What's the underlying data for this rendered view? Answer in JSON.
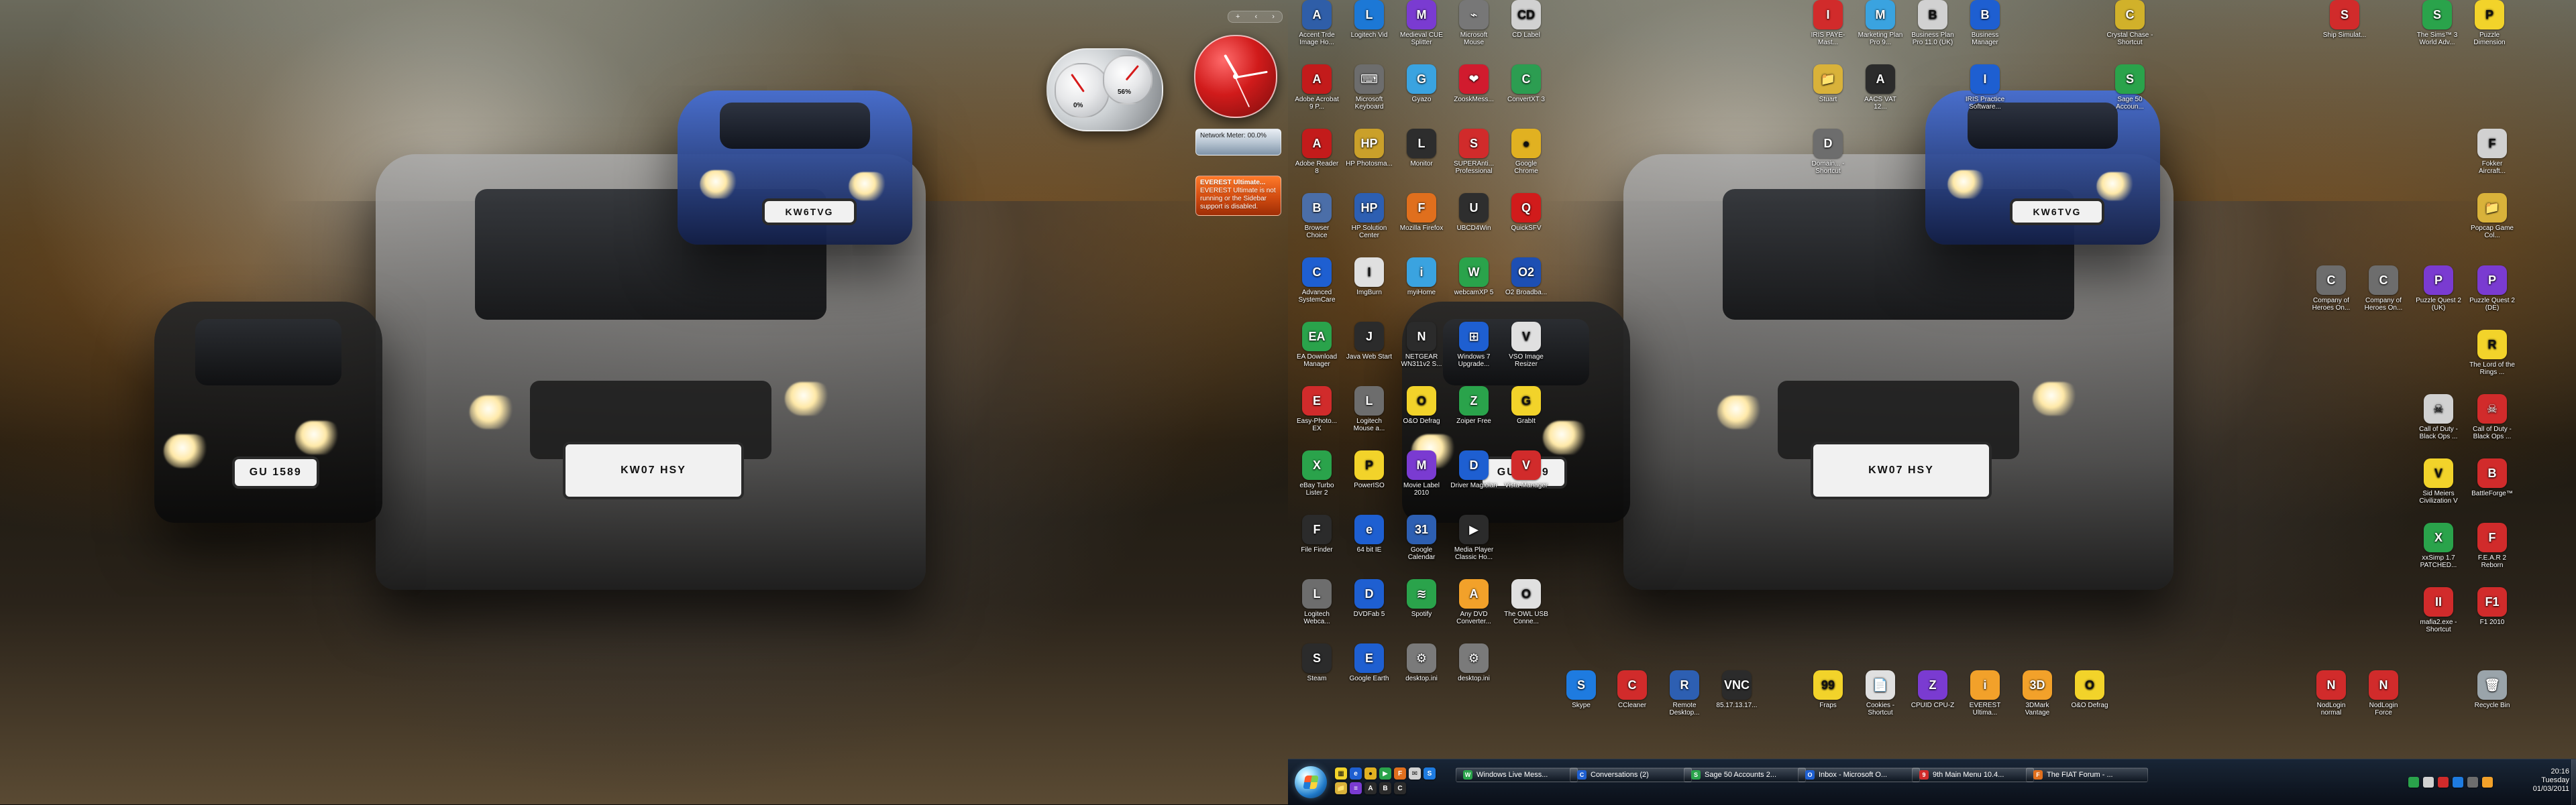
{
  "wallpaper": {
    "left": {
      "plate_front": "KW07 HSY",
      "plate_left": "GU 1589",
      "plate_back": "KW6TVG"
    },
    "right": {
      "plate_front": "KW07 HSY",
      "plate_left": "GU 1589",
      "plate_back": "KW6TVG"
    }
  },
  "sidebar": {
    "controls": [
      "+",
      "‹",
      "›"
    ],
    "network_meter": "Network Meter: 00.0%",
    "everest_lines": [
      "EVEREST Ultimate...",
      "EVEREST Ultimate is not",
      "running or the Sidebar",
      "support is disabled."
    ],
    "cpu_gauge": {
      "cpu_pct": "0%",
      "mem_pct": "56%"
    }
  },
  "desktop": {
    "left_grid": [
      {
        "name": "accent-image-icon",
        "label": "Accent Trde Image Ho...",
        "glyph": "A",
        "color": "#2f5ea8"
      },
      {
        "name": "logitech-vid-icon",
        "label": "Logitech Vid",
        "glyph": "L",
        "color": "#1c78d6"
      },
      {
        "name": "medieval-cue-splitter-icon",
        "label": "Medieval CUE Splitter",
        "glyph": "M",
        "color": "#7a3bd1"
      },
      {
        "name": "microsoft-mouse-icon",
        "label": "Microsoft Mouse",
        "glyph": "⌁",
        "color": "#777"
      },
      {
        "name": "cd-label-icon",
        "label": "CD Label",
        "glyph": "CD",
        "color": "#d1d1d1"
      },
      {
        "name": "adobe-acrobat-icon",
        "label": "Adobe Acrobat 9 P...",
        "glyph": "A",
        "color": "#c31b1b"
      },
      {
        "name": "microsoft-keyboard-icon",
        "label": "Microsoft Keyboard",
        "glyph": "⌨",
        "color": "#6d6d6d"
      },
      {
        "name": "gyazo-icon",
        "label": "Gyazo",
        "glyph": "G",
        "color": "#3aa3e0"
      },
      {
        "name": "zooskmess-icon",
        "label": "ZooskMess...",
        "glyph": "❤",
        "color": "#d11b2e"
      },
      {
        "name": "convertxt-icon",
        "label": "ConvertXT 3",
        "glyph": "C",
        "color": "#2c9d51"
      },
      {
        "name": "adobe-reader-icon",
        "label": "Adobe Reader 8",
        "glyph": "A",
        "color": "#c31b1b"
      },
      {
        "name": "hp-photosmart-icon",
        "label": "HP Photosma...",
        "glyph": "HP",
        "color": "#caa02a"
      },
      {
        "name": "lenovo-monitor-icon",
        "label": "Monitor",
        "glyph": "L",
        "color": "#2d2d2d"
      },
      {
        "name": "superantispyware-icon",
        "label": "SUPERAnti... Professional",
        "glyph": "S",
        "color": "#d12b2b"
      },
      {
        "name": "google-chrome-icon",
        "label": "Google Chrome",
        "glyph": "●",
        "color": "#e1b121"
      },
      {
        "name": "browser-choice-icon",
        "label": "Browser Choice",
        "glyph": "B",
        "color": "#4b6ea8"
      },
      {
        "name": "hp-solution-center-icon",
        "label": "HP Solution Center",
        "glyph": "HP",
        "color": "#2d5fb2"
      },
      {
        "name": "mozilla-firefox-icon",
        "label": "Mozilla Firefox",
        "glyph": "F",
        "color": "#e06f1d"
      },
      {
        "name": "ubcd4win-icon",
        "label": "UBCD4Win",
        "glyph": "U",
        "color": "#2e2e2e"
      },
      {
        "name": "quicksfv-icon",
        "label": "QuickSFV",
        "glyph": "Q",
        "color": "#d11b1b"
      },
      {
        "name": "advanced-systemcare-icon",
        "label": "Advanced SystemCare",
        "glyph": "C",
        "color": "#1e5fd1"
      },
      {
        "name": "imgburn-icon",
        "label": "ImgBurn",
        "glyph": "I",
        "color": "#e0e0e0"
      },
      {
        "name": "myihome-icon",
        "label": "myiHome",
        "glyph": "i",
        "color": "#3aa3e0"
      },
      {
        "name": "webcamxp-icon",
        "label": "webcamXP 5",
        "glyph": "W",
        "color": "#2aa34b"
      },
      {
        "name": "o2-broadband-icon",
        "label": "O2 Broadba...",
        "glyph": "O2",
        "color": "#1d4fb3"
      },
      {
        "name": "ea-download-manager-icon",
        "label": "EA Download Manager",
        "glyph": "EA",
        "color": "#2aa34b"
      },
      {
        "name": "java-web-start-icon",
        "label": "Java Web Start",
        "glyph": "J",
        "color": "#2b2b2b"
      },
      {
        "name": "netgear-icon",
        "label": "NETGEAR WN311v2 S...",
        "glyph": "N",
        "color": "#2b2b2b"
      },
      {
        "name": "windows7-upgrade-icon",
        "label": "Windows 7 Upgrade...",
        "glyph": "⊞",
        "color": "#1e5fd1"
      },
      {
        "name": "vso-image-resizer-icon",
        "label": "VSO Image Resizer",
        "glyph": "V",
        "color": "#e0e0e0"
      },
      {
        "name": "easy-photo-icon",
        "label": "Easy-Photo... EX",
        "glyph": "E",
        "color": "#d12b2b"
      },
      {
        "name": "logitech-mouse-icon",
        "label": "Logitech Mouse a...",
        "glyph": "L",
        "color": "#6d6d6d"
      },
      {
        "name": "odefrag-icon",
        "label": "O&O Defrag",
        "glyph": "O",
        "color": "#f2d32a"
      },
      {
        "name": "zoiper-free-icon",
        "label": "Zoiper Free",
        "glyph": "Z",
        "color": "#2aa34b"
      },
      {
        "name": "grabit-icon",
        "label": "GrabIt",
        "glyph": "G",
        "color": "#f2d32a"
      },
      {
        "name": "ebay-turbo-lister-icon",
        "label": "eBay Turbo Lister 2",
        "glyph": "X",
        "color": "#2aa34b"
      },
      {
        "name": "poweriso-icon",
        "label": "PowerISO",
        "glyph": "P",
        "color": "#f2d32a"
      },
      {
        "name": "movie-label-icon",
        "label": "Movie Label 2010",
        "glyph": "M",
        "color": "#7a3bd1"
      },
      {
        "name": "driver-magician-icon",
        "label": "Driver Magician",
        "glyph": "D",
        "color": "#1e5fd1"
      },
      {
        "name": "vista-manager-icon",
        "label": "Vista Manager",
        "glyph": "V",
        "color": "#d12b2b"
      },
      {
        "name": "file-finder-icon",
        "label": "File Finder",
        "glyph": "F",
        "color": "#2b2b2b"
      },
      {
        "name": "ie64-icon",
        "label": "64 bit IE",
        "glyph": "e",
        "color": "#1e5fd1"
      },
      {
        "name": "google-calendar-icon",
        "label": "Google Calendar",
        "glyph": "31",
        "color": "#2d5fb2"
      },
      {
        "name": "media-player-classic-icon",
        "label": "Media Player Classic Ho...",
        "glyph": "▶",
        "color": "#2b2b2b"
      },
      {
        "name": "blank-icon-1",
        "label": "",
        "glyph": "",
        "color": "rgba(0,0,0,0)"
      },
      {
        "name": "logitech-webcam-icon",
        "label": "Logitech Webca...",
        "glyph": "L",
        "color": "#6d6d6d"
      },
      {
        "name": "dvdfab-icon",
        "label": "DVDFab 5",
        "glyph": "D",
        "color": "#1e5fd1"
      },
      {
        "name": "spotify-icon",
        "label": "Spotify",
        "glyph": "≋",
        "color": "#2aa34b"
      },
      {
        "name": "any-dvd-converter-icon",
        "label": "Any DVD Converter...",
        "glyph": "A",
        "color": "#f2a12a"
      },
      {
        "name": "the-owl-usb-icon",
        "label": "The OWL USB Conne...",
        "glyph": "O",
        "color": "#e0e0e0"
      },
      {
        "name": "steam-icon",
        "label": "Steam",
        "glyph": "S",
        "color": "#2b2b2b"
      },
      {
        "name": "google-earth-icon",
        "label": "Google Earth",
        "glyph": "E",
        "color": "#1e5fd1"
      },
      {
        "name": "desktop-ini-icon-1",
        "label": "desktop.ini",
        "glyph": "⚙",
        "color": "#7a7a7a"
      },
      {
        "name": "desktop-ini-icon-2",
        "label": "desktop.ini",
        "glyph": "⚙",
        "color": "#7a7a7a"
      },
      {
        "name": "blank-icon-2",
        "label": "",
        "glyph": "",
        "color": "rgba(0,0,0,0)"
      }
    ],
    "mid_row": [
      {
        "name": "skype-icon",
        "label": "Skype",
        "glyph": "S",
        "color": "#1e7be0"
      },
      {
        "name": "ccleaner-icon",
        "label": "CCleaner",
        "glyph": "C",
        "color": "#d12b2b"
      },
      {
        "name": "remote-desktop-icon",
        "label": "Remote Desktop...",
        "glyph": "R",
        "color": "#2d5fb2"
      },
      {
        "name": "vnc-icon",
        "label": "85.17.13.17...",
        "glyph": "VNC",
        "color": "#2b2b2b"
      }
    ],
    "right_col_top": [
      {
        "name": "iris-paye-master-icon",
        "label": "IRIS PAYE-Mast...",
        "glyph": "I",
        "color": "#d12b2b"
      },
      {
        "name": "marketing-plan-pro-icon",
        "label": "Marketing Plan Pro 9...",
        "glyph": "M",
        "color": "#3aa3e0"
      },
      {
        "name": "business-plan-pro-icon",
        "label": "Business Plan Pro 11.0 (UK)",
        "glyph": "B",
        "color": "#d1d1d1"
      },
      {
        "name": "business-manager-icon",
        "label": "Business Manager",
        "glyph": "B",
        "color": "#1e5fd1"
      },
      {
        "name": "blank-icon-3",
        "label": "",
        "glyph": "",
        "color": "rgba(0,0,0,0)"
      },
      {
        "name": "crystal-chase-icon",
        "label": "Crystal Chase - Shortcut",
        "glyph": "C",
        "color": "#d1b12a"
      }
    ],
    "right_col_second": [
      {
        "name": "stuart-folder-icon",
        "label": "Stuart",
        "glyph": "📁",
        "color": "#d9b23a"
      },
      {
        "name": "aacs-vat-icon",
        "label": "AACS VAT 12...",
        "glyph": "A",
        "color": "#2b2b2b"
      },
      {
        "name": "blank-icon-4",
        "label": "",
        "glyph": "",
        "color": "rgba(0,0,0,0)"
      },
      {
        "name": "iris-practice-icon",
        "label": "IRIS Practice Software...",
        "glyph": "I",
        "color": "#1e5fd1"
      },
      {
        "name": "blank-icon-5",
        "label": "",
        "glyph": "",
        "color": "rgba(0,0,0,0)"
      },
      {
        "name": "sage-50-icon",
        "label": "Sage 50 Accoun...",
        "glyph": "S",
        "color": "#2aa34b"
      }
    ],
    "right_col_third": [
      {
        "name": "domain-shortcut-icon",
        "label": "Domain... - Shortcut",
        "glyph": "D",
        "color": "#6d6d6d"
      }
    ],
    "far_right_top": [
      {
        "name": "ship-simulator-icon",
        "label": "Ship Simulat...",
        "glyph": "S",
        "color": "#d12b2b"
      },
      {
        "name": "the-sims3-icon",
        "label": "The Sims™ 3 World Adv...",
        "glyph": "S",
        "color": "#2aa34b"
      },
      {
        "name": "puzzle-dimension-icon",
        "label": "Puzzle Dimension",
        "glyph": "P",
        "color": "#f2d32a"
      }
    ],
    "far_right_mid": [
      {
        "name": "fokker-aircraft-icon",
        "label": "Fokker Aircraft...",
        "glyph": "F",
        "color": "#d1d1d1"
      },
      {
        "name": "popcap-folder-icon",
        "label": "Popcap Game Col...",
        "glyph": "📁",
        "color": "#d9b23a"
      },
      {
        "name": "company-heroes-1-icon",
        "label": "Company of Heroes On...",
        "glyph": "C",
        "color": "#6d6d6d"
      },
      {
        "name": "company-heroes-2-icon",
        "label": "Company of Heroes On...",
        "glyph": "C",
        "color": "#6d6d6d"
      },
      {
        "name": "puzzle-quest2-uk-icon",
        "label": "Puzzle Quest 2 (UK)",
        "glyph": "P",
        "color": "#7a3bd1"
      },
      {
        "name": "puzzle-quest2-de-icon",
        "label": "Puzzle Quest 2 (DE)",
        "glyph": "P",
        "color": "#7a3bd1"
      },
      {
        "name": "lord-rings-icon",
        "label": "The Lord of the Rings ...",
        "glyph": "R",
        "color": "#f2d32a"
      },
      {
        "name": "cod-black-ops-1-icon",
        "label": "Call of Duty - Black Ops ...",
        "glyph": "☠",
        "color": "#d1d1d1"
      },
      {
        "name": "cod-black-ops-2-icon",
        "label": "Call of Duty - Black Ops ...",
        "glyph": "☠",
        "color": "#d12b2b"
      },
      {
        "name": "sid-meiers-icon",
        "label": "Sid Meiers Civilization V",
        "glyph": "V",
        "color": "#f2d32a"
      },
      {
        "name": "battleforge-icon",
        "label": "BattleForge™",
        "glyph": "B",
        "color": "#d12b2b"
      },
      {
        "name": "fear-reborn-icon",
        "label": "F.E.A.R 2 Reborn",
        "glyph": "F",
        "color": "#d12b2b"
      },
      {
        "name": "xsimp-icon",
        "label": "xxSimp 1.7 PATCHED...",
        "glyph": "X",
        "color": "#2aa34b"
      },
      {
        "name": "mafia-shortcut-icon",
        "label": "mafia2.exe - Shortcut",
        "glyph": "II",
        "color": "#d12b2b"
      },
      {
        "name": "f1-2010-icon",
        "label": "F1 2010",
        "glyph": "F1",
        "color": "#d12b2b"
      }
    ],
    "far_right_bottom": [
      {
        "name": "nodlogin-normal-icon",
        "label": "NodLogin normal",
        "glyph": "N",
        "color": "#d12b2b"
      },
      {
        "name": "nodlogin-force-icon",
        "label": "NodLogin Force",
        "glyph": "N",
        "color": "#d12b2b"
      },
      {
        "name": "recycle-bin-icon",
        "label": "Recycle Bin",
        "glyph": "🗑",
        "color": "#9aa4aa"
      }
    ],
    "mid_lower_row": [
      {
        "name": "fraps-icon",
        "label": "Fraps",
        "glyph": "99",
        "color": "#f2d32a"
      },
      {
        "name": "cookies-shortcut-icon",
        "label": "Cookies - Shortcut",
        "glyph": "📄",
        "color": "#e0e0e0"
      },
      {
        "name": "cpuid-cpuz-icon",
        "label": "CPUID CPU-Z",
        "glyph": "Z",
        "color": "#7a3bd1"
      },
      {
        "name": "everest-ultimate-icon",
        "label": "EVEREST Ultima...",
        "glyph": "i",
        "color": "#f2a12a"
      },
      {
        "name": "3dmark-icon",
        "label": "3DMark Vantage",
        "glyph": "3D",
        "color": "#f2a12a"
      },
      {
        "name": "odefrag-2-icon",
        "label": "O&O Defrag",
        "glyph": "O",
        "color": "#f2d32a"
      }
    ]
  },
  "taskbar": {
    "quick_launch": [
      {
        "name": "ql-explorer-icon",
        "glyph": "▦",
        "color": "#f2d32a"
      },
      {
        "name": "ql-ie-icon",
        "glyph": "e",
        "color": "#1e5fd1"
      },
      {
        "name": "ql-chrome-icon",
        "glyph": "●",
        "color": "#e1b121"
      },
      {
        "name": "ql-media-icon",
        "glyph": "▶",
        "color": "#2aa34b"
      },
      {
        "name": "ql-firefox-icon",
        "glyph": "F",
        "color": "#e06f1d"
      },
      {
        "name": "ql-mail-icon",
        "glyph": "✉",
        "color": "#d1d1d1"
      },
      {
        "name": "ql-skype-icon",
        "glyph": "S",
        "color": "#1e7be0"
      },
      {
        "name": "ql-folder-icon",
        "glyph": "📁",
        "color": "#d9b23a"
      },
      {
        "name": "ql-notes-icon",
        "glyph": "≡",
        "color": "#7a3bd1"
      },
      {
        "name": "ql-app-icon",
        "glyph": "A",
        "color": "#2b2b2b"
      },
      {
        "name": "ql-app2-icon",
        "glyph": "B",
        "color": "#2b2b2b"
      },
      {
        "name": "ql-app3-icon",
        "glyph": "C",
        "color": "#2b2b2b"
      }
    ],
    "tasks": [
      {
        "name": "task-windows-live-messenger",
        "label": "Windows Live Mess...",
        "glyph": "W",
        "color": "#2aa34b"
      },
      {
        "name": "task-conversations",
        "label": "Conversations (2)",
        "glyph": "C",
        "color": "#1e5fd1"
      },
      {
        "name": "task-sage-50",
        "label": "Sage 50 Accounts 2...",
        "glyph": "S",
        "color": "#2aa34b"
      },
      {
        "name": "task-inbox-outlook",
        "label": "Inbox - Microsoft O...",
        "glyph": "O",
        "color": "#1e5fd1"
      },
      {
        "name": "task-9th-main-menu",
        "label": "9th Main Menu 10.4...",
        "glyph": "9",
        "color": "#d12b2b"
      },
      {
        "name": "task-fiat-forum",
        "label": "The FIAT Forum - ...",
        "glyph": "F",
        "color": "#e06f1d"
      }
    ],
    "tray": {
      "time": "20:16",
      "day": "Tuesday",
      "date": "01/03/2011"
    }
  }
}
